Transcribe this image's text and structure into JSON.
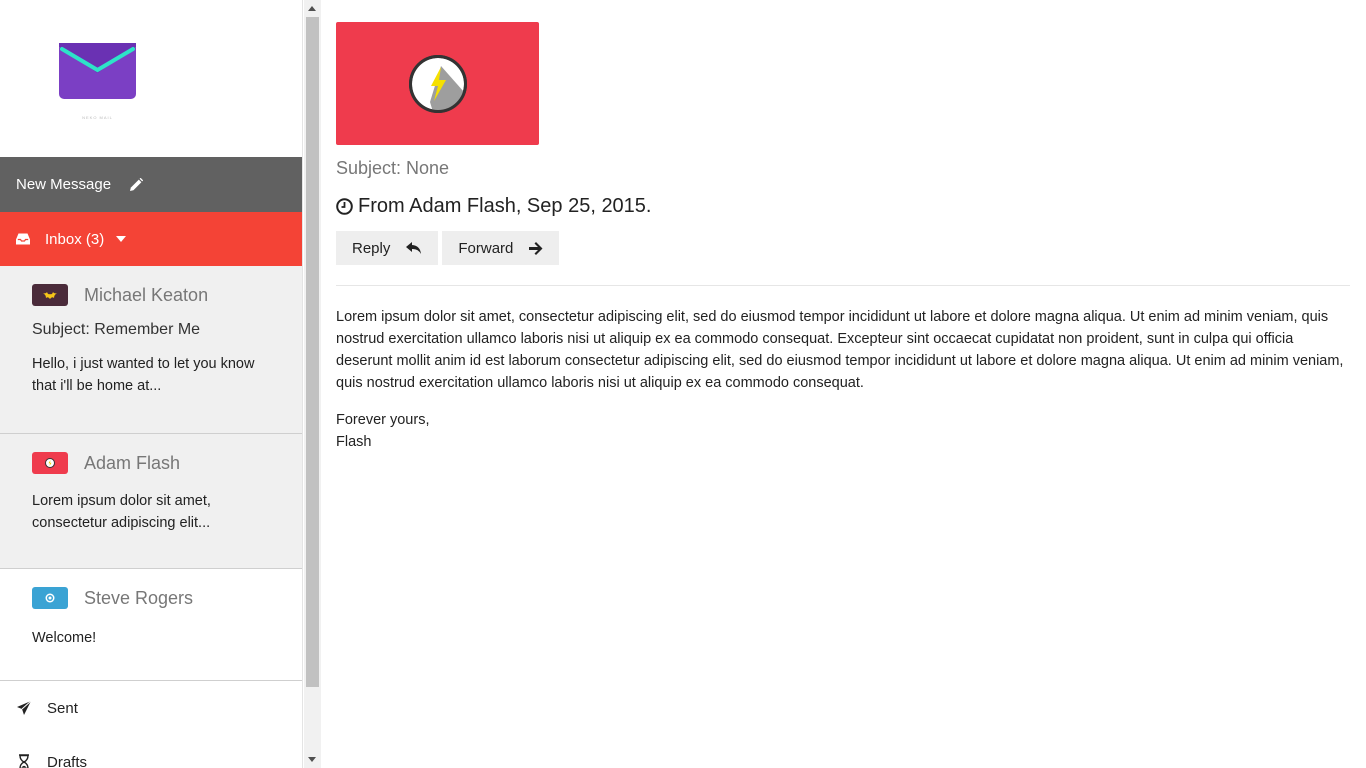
{
  "app": {
    "logo_caption": "NEKO MAIL"
  },
  "sidebar": {
    "new_message_label": "New Message",
    "inbox_label": "Inbox (3)",
    "messages": [
      {
        "sender": "Michael Keaton",
        "subject": "Subject: Remember Me",
        "snippet": "Hello, i just wanted to let you know that i'll be home at...",
        "avatar_icon": "bat-logo-icon",
        "avatar_color": "#4a2b3a"
      },
      {
        "sender": "Adam Flash",
        "subject": "",
        "snippet": "Lorem ipsum dolor sit amet, consectetur adipiscing elit...",
        "avatar_icon": "flash-logo-icon",
        "avatar_color": "#ef3b4d"
      },
      {
        "sender": "Steve Rogers",
        "subject": "",
        "snippet": "Welcome!",
        "avatar_icon": "shield-logo-icon",
        "avatar_color": "#3aa3d4"
      }
    ],
    "nav": [
      {
        "label": "Sent",
        "icon": "paper-plane-icon"
      },
      {
        "label": "Drafts",
        "icon": "hourglass-icon"
      }
    ]
  },
  "email": {
    "subject": "Subject: None",
    "from": "From Adam Flash, Sep 25, 2015.",
    "reply_label": "Reply",
    "forward_label": "Forward",
    "body": "Lorem ipsum dolor sit amet, consectetur adipiscing elit, sed do eiusmod tempor incididunt ut labore et dolore magna aliqua. Ut enim ad minim veniam, quis nostrud exercitation ullamco laboris nisi ut aliquip ex ea commodo consequat. Excepteur sint occaecat cupidatat non proident, sunt in culpa qui officia deserunt mollit anim id est laborum consectetur adipiscing elit, sed do eiusmod tempor incididunt ut labore et dolore magna aliqua. Ut enim ad minim veniam, quis nostrud exercitation ullamco laboris nisi ut aliquip ex ea commodo consequat.",
    "closing_1": "Forever yours,",
    "closing_2": "Flash"
  },
  "colors": {
    "accent": "#f44336",
    "dark_bar": "#616161",
    "flash_red": "#ef3b4d"
  }
}
